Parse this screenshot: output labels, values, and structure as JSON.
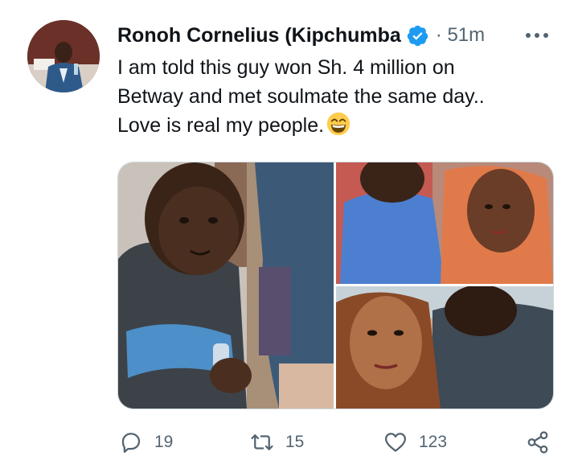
{
  "tweet": {
    "author_name": "Ronoh Cornelius (Kipchumba",
    "verified": true,
    "time": "· 51m",
    "text_lines": [
      "I am told this guy won Sh. 4 million on",
      "Betway and met soulmate the same day..",
      "Love is real my people."
    ],
    "emoji": "grinning-face-with-smiling-eyes",
    "media": [
      {
        "icon": "photo-man-holding-bottle"
      },
      {
        "icon": "photo-man-and-woman"
      },
      {
        "icon": "photo-woman-selfie-with-man"
      }
    ]
  },
  "actions": {
    "reply_count": "19",
    "retweet_count": "15",
    "like_count": "123"
  },
  "colors": {
    "text": "#0f1419",
    "secondary": "#536471",
    "verified_blue": "#1d9bf0",
    "border": "#cfd9de"
  }
}
